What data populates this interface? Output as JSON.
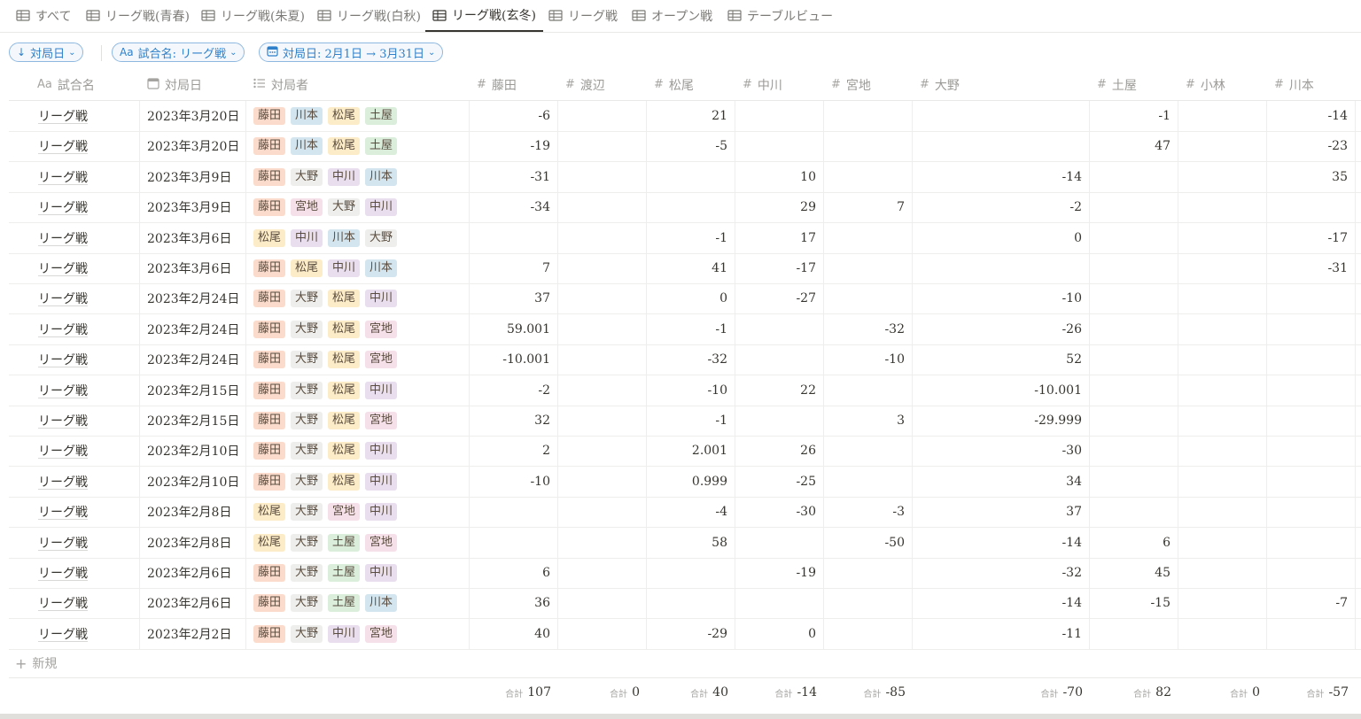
{
  "tabs": [
    {
      "label": "すべて",
      "active": false
    },
    {
      "label": "リーグ戦(青春)",
      "active": false
    },
    {
      "label": "リーグ戦(朱夏)",
      "active": false
    },
    {
      "label": "リーグ戦(白秋)",
      "active": false
    },
    {
      "label": "リーグ戦(玄冬)",
      "active": true
    },
    {
      "label": "リーグ戦",
      "active": false
    },
    {
      "label": "オープン戦",
      "active": false
    },
    {
      "label": "テーブルビュー",
      "active": false
    }
  ],
  "filters": {
    "sort": {
      "icon": "↓",
      "label": "対局日"
    },
    "name": {
      "icon": "Aa",
      "label": "試合名: リーグ戦"
    },
    "date": {
      "icon": "calendar-icon",
      "label": "対局日: 2月1日 → 3月31日"
    }
  },
  "columns": {
    "name": "試合名",
    "date": "対局日",
    "players": "対局者",
    "scores": [
      "藤田",
      "渡辺",
      "松尾",
      "中川",
      "宮地",
      "大野",
      "土屋",
      "小林",
      "川本"
    ]
  },
  "tag_colors": {
    "藤田": "#fbdccc",
    "川本": "#d3e5ef",
    "松尾": "#fdecc8",
    "土屋": "#dbeddb",
    "大野": "#eeeeec",
    "中川": "#e8deee",
    "宮地": "#f5e0e9"
  },
  "rows": [
    {
      "name": "リーグ戦",
      "date": "2023年3月20日",
      "players": [
        "藤田",
        "川本",
        "松尾",
        "土屋"
      ],
      "scores": [
        "-6",
        "",
        "21",
        "",
        "",
        "",
        "-1",
        "",
        "-14"
      ]
    },
    {
      "name": "リーグ戦",
      "date": "2023年3月20日",
      "players": [
        "藤田",
        "川本",
        "松尾",
        "土屋"
      ],
      "scores": [
        "-19",
        "",
        "-5",
        "",
        "",
        "",
        "47",
        "",
        "-23"
      ]
    },
    {
      "name": "リーグ戦",
      "date": "2023年3月9日",
      "players": [
        "藤田",
        "大野",
        "中川",
        "川本"
      ],
      "scores": [
        "-31",
        "",
        "",
        "10",
        "",
        "-14",
        "",
        "",
        "35"
      ]
    },
    {
      "name": "リーグ戦",
      "date": "2023年3月9日",
      "players": [
        "藤田",
        "宮地",
        "大野",
        "中川"
      ],
      "scores": [
        "-34",
        "",
        "",
        "29",
        "7",
        "-2",
        "",
        "",
        ""
      ]
    },
    {
      "name": "リーグ戦",
      "date": "2023年3月6日",
      "players": [
        "松尾",
        "中川",
        "川本",
        "大野"
      ],
      "scores": [
        "",
        "",
        "-1",
        "17",
        "",
        "0",
        "",
        "",
        "-17"
      ]
    },
    {
      "name": "リーグ戦",
      "date": "2023年3月6日",
      "players": [
        "藤田",
        "松尾",
        "中川",
        "川本"
      ],
      "scores": [
        "7",
        "",
        "41",
        "-17",
        "",
        "",
        "",
        "",
        "-31"
      ]
    },
    {
      "name": "リーグ戦",
      "date": "2023年2月24日",
      "players": [
        "藤田",
        "大野",
        "松尾",
        "中川"
      ],
      "scores": [
        "37",
        "",
        "0",
        "-27",
        "",
        "-10",
        "",
        "",
        ""
      ]
    },
    {
      "name": "リーグ戦",
      "date": "2023年2月24日",
      "players": [
        "藤田",
        "大野",
        "松尾",
        "宮地"
      ],
      "scores": [
        "59.001",
        "",
        "-1",
        "",
        "-32",
        "-26",
        "",
        "",
        ""
      ]
    },
    {
      "name": "リーグ戦",
      "date": "2023年2月24日",
      "players": [
        "藤田",
        "大野",
        "松尾",
        "宮地"
      ],
      "scores": [
        "-10.001",
        "",
        "-32",
        "",
        "-10",
        "52",
        "",
        "",
        ""
      ]
    },
    {
      "name": "リーグ戦",
      "date": "2023年2月15日",
      "players": [
        "藤田",
        "大野",
        "松尾",
        "中川"
      ],
      "scores": [
        "-2",
        "",
        "-10",
        "22",
        "",
        "-10.001",
        "",
        "",
        ""
      ]
    },
    {
      "name": "リーグ戦",
      "date": "2023年2月15日",
      "players": [
        "藤田",
        "大野",
        "松尾",
        "宮地"
      ],
      "scores": [
        "32",
        "",
        "-1",
        "",
        "3",
        "-29.999",
        "",
        "",
        ""
      ]
    },
    {
      "name": "リーグ戦",
      "date": "2023年2月10日",
      "players": [
        "藤田",
        "大野",
        "松尾",
        "中川"
      ],
      "scores": [
        "2",
        "",
        "2.001",
        "26",
        "",
        "-30",
        "",
        "",
        ""
      ]
    },
    {
      "name": "リーグ戦",
      "date": "2023年2月10日",
      "players": [
        "藤田",
        "大野",
        "松尾",
        "中川"
      ],
      "scores": [
        "-10",
        "",
        "0.999",
        "-25",
        "",
        "34",
        "",
        "",
        ""
      ]
    },
    {
      "name": "リーグ戦",
      "date": "2023年2月8日",
      "players": [
        "松尾",
        "大野",
        "宮地",
        "中川"
      ],
      "scores": [
        "",
        "",
        "-4",
        "-30",
        "-3",
        "37",
        "",
        "",
        ""
      ]
    },
    {
      "name": "リーグ戦",
      "date": "2023年2月8日",
      "players": [
        "松尾",
        "大野",
        "土屋",
        "宮地"
      ],
      "scores": [
        "",
        "",
        "58",
        "",
        "-50",
        "-14",
        "6",
        "",
        ""
      ]
    },
    {
      "name": "リーグ戦",
      "date": "2023年2月6日",
      "players": [
        "藤田",
        "大野",
        "土屋",
        "中川"
      ],
      "scores": [
        "6",
        "",
        "",
        "-19",
        "",
        "-32",
        "45",
        "",
        ""
      ]
    },
    {
      "name": "リーグ戦",
      "date": "2023年2月6日",
      "players": [
        "藤田",
        "大野",
        "土屋",
        "川本"
      ],
      "scores": [
        "36",
        "",
        "",
        "",
        "",
        "-14",
        "-15",
        "",
        "-7"
      ]
    },
    {
      "name": "リーグ戦",
      "date": "2023年2月2日",
      "players": [
        "藤田",
        "大野",
        "中川",
        "宮地"
      ],
      "scores": [
        "40",
        "",
        "-29",
        "0",
        "",
        "-11",
        "",
        "",
        ""
      ]
    }
  ],
  "new_row_label": "新規",
  "sum_label": "合計",
  "sums": [
    "107",
    "0",
    "40",
    "-14",
    "-85",
    "-70",
    "82",
    "0",
    "-57"
  ]
}
